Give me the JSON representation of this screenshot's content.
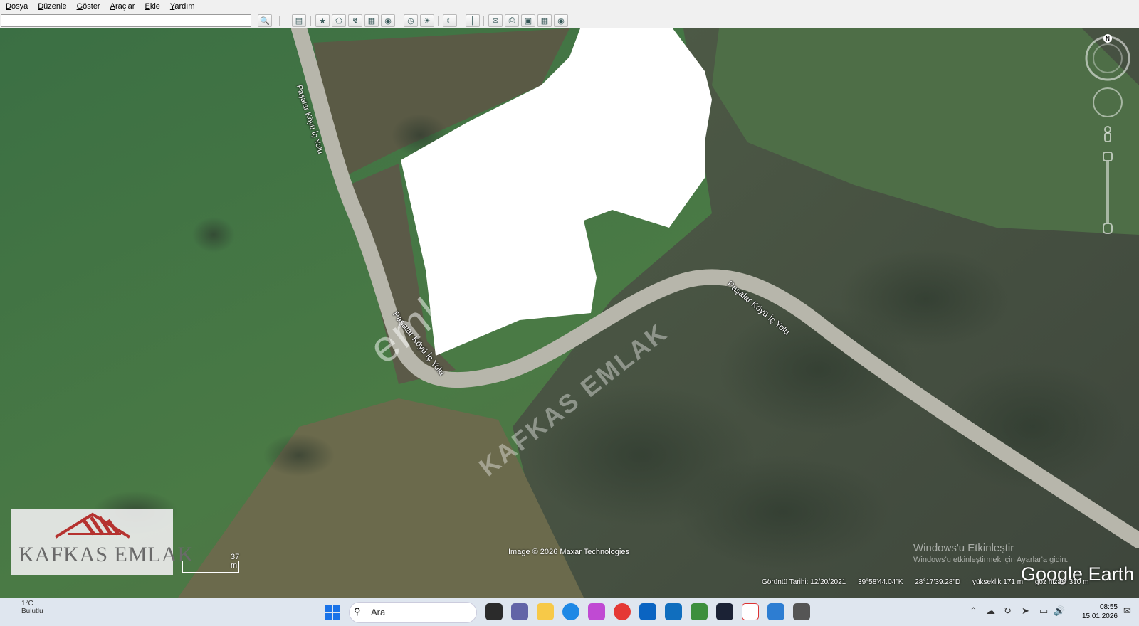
{
  "menu": [
    "Dosya",
    "Düzenle",
    "Göster",
    "Araçlar",
    "Ekle",
    "Yardım"
  ],
  "search": {
    "value": ""
  },
  "map": {
    "road_labels": [
      "Paşalar Köyü İç Yolu",
      "Paşalar Köyü İç Yolu",
      "Paşalar Köyü İç Yolu"
    ],
    "watermark_primary": "emlakjet.com",
    "watermark_secondary": "KAFKAS EMLAK",
    "imagery_credit": "Image © 2026 Maxar Technologies",
    "scale_label": "37 m",
    "windows_activation_title": "Windows'u Etkinleştir",
    "windows_activation_sub": "Windows'u etkinleştirmek için Ayarlar'a gidin.",
    "brand": "Google Earth",
    "compass_north": "N"
  },
  "status": {
    "imagery_date": "Görüntü Tarihi: 12/20/2021",
    "latitude": "39°58'44.04\"K",
    "longitude": "28°17'39.28\"D",
    "elevation": "yükseklik  171 m",
    "eye_altitude": "göz hizası  310 m"
  },
  "logo": {
    "name": "KAFKAS EMLAK"
  },
  "taskbar": {
    "weather_temp": "1°C",
    "weather_desc": "Bulutlu",
    "search_placeholder": "Ara",
    "time": "08:55",
    "date": "15.01.2026"
  },
  "colors": {
    "field_green": "#3f7042",
    "forest": "#4a5448",
    "road": "#b9b8ae",
    "parcel": "#ffffff"
  }
}
